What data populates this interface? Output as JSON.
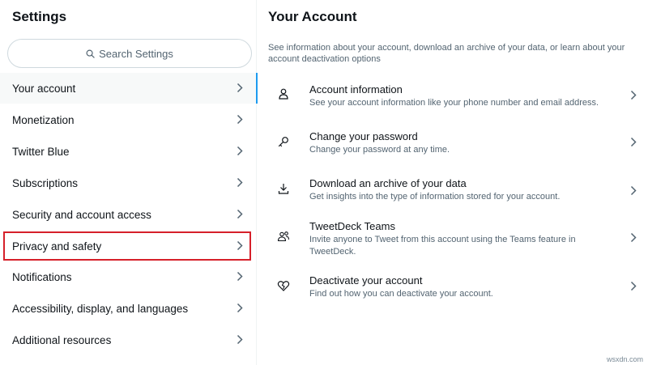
{
  "left": {
    "title": "Settings",
    "search_placeholder": "Search Settings",
    "items": [
      {
        "label": "Your account"
      },
      {
        "label": "Monetization"
      },
      {
        "label": "Twitter Blue"
      },
      {
        "label": "Subscriptions"
      },
      {
        "label": "Security and account access"
      },
      {
        "label": "Privacy and safety"
      },
      {
        "label": "Notifications"
      },
      {
        "label": "Accessibility, display, and languages"
      },
      {
        "label": "Additional resources"
      }
    ]
  },
  "right": {
    "title": "Your Account",
    "description": "See information about your account, download an archive of your data, or learn about your account deactivation options",
    "items": [
      {
        "label": "Account information",
        "desc": "See your account information like your phone number and email address.",
        "icon": "person-icon"
      },
      {
        "label": "Change your password",
        "desc": "Change your password at any time.",
        "icon": "key-icon"
      },
      {
        "label": "Download an archive of your data",
        "desc": "Get insights into the type of information stored for your account.",
        "icon": "download-icon"
      },
      {
        "label": "TweetDeck Teams",
        "desc": "Invite anyone to Tweet from this account using the Teams feature in TweetDeck.",
        "icon": "people-icon"
      },
      {
        "label": "Deactivate your account",
        "desc": "Find out how you can deactivate your account.",
        "icon": "broken-heart-icon"
      }
    ]
  },
  "watermark": "wsxdn.com",
  "colors": {
    "accent": "#1d9bf0",
    "highlight_border": "#d6202a",
    "secondary_text": "#536471"
  }
}
